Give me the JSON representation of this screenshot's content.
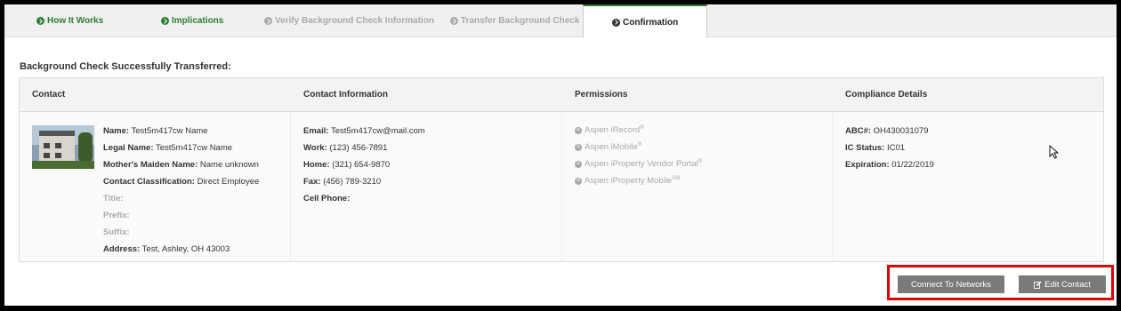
{
  "tabs": [
    {
      "label": "How It Works",
      "state": "done"
    },
    {
      "label": "Implications",
      "state": "done"
    },
    {
      "label": "Verify Background Check Information",
      "state": "pending"
    },
    {
      "label": "Transfer Background Check",
      "state": "pending"
    },
    {
      "label": "Confirmation",
      "state": "active"
    }
  ],
  "heading": "Background Check Successfully Transferred:",
  "columns": [
    "Contact",
    "Contact Information",
    "Permissions",
    "Compliance Details"
  ],
  "contact": {
    "name_label": "Name:",
    "name": "Test5m417cw Name",
    "legal_label": "Legal Name:",
    "legal": "Test5m417cw Name",
    "maiden_label": "Mother's Maiden Name:",
    "maiden": "Name unknown",
    "class_label": "Contact Classification:",
    "class": "Direct Employee",
    "title_label": "Title:",
    "prefix_label": "Prefix:",
    "suffix_label": "Suffix:",
    "address_label": "Address:",
    "address": "Test, Ashley, OH 43003"
  },
  "contact_info": {
    "email_label": "Email:",
    "email": "Test5m417cw@mail.com",
    "work_label": "Work:",
    "work": "(123) 456-7891",
    "home_label": "Home:",
    "home": "(321) 654-9870",
    "fax_label": "Fax:",
    "fax": "(456) 789-3210",
    "cell_label": "Cell Phone:"
  },
  "permissions": [
    {
      "label": "Aspen iRecord",
      "mark": "®"
    },
    {
      "label": "Aspen iMobile",
      "mark": "®"
    },
    {
      "label": "Aspen iProperty Vendor Portal",
      "mark": "®"
    },
    {
      "label": "Aspen iProperty Mobile",
      "mark": "SM"
    }
  ],
  "compliance": {
    "abc_label": "ABC#:",
    "abc": "OH430031079",
    "ic_label": "IC Status:",
    "ic": "IC01",
    "exp_label": "Expiration:",
    "exp": "01/22/2019"
  },
  "buttons": {
    "connect": "Connect To Networks",
    "edit": "Edit Contact"
  },
  "colors": {
    "accent": "#2e7d32",
    "highlight": "#e00000",
    "button": "#7a7a7a"
  }
}
